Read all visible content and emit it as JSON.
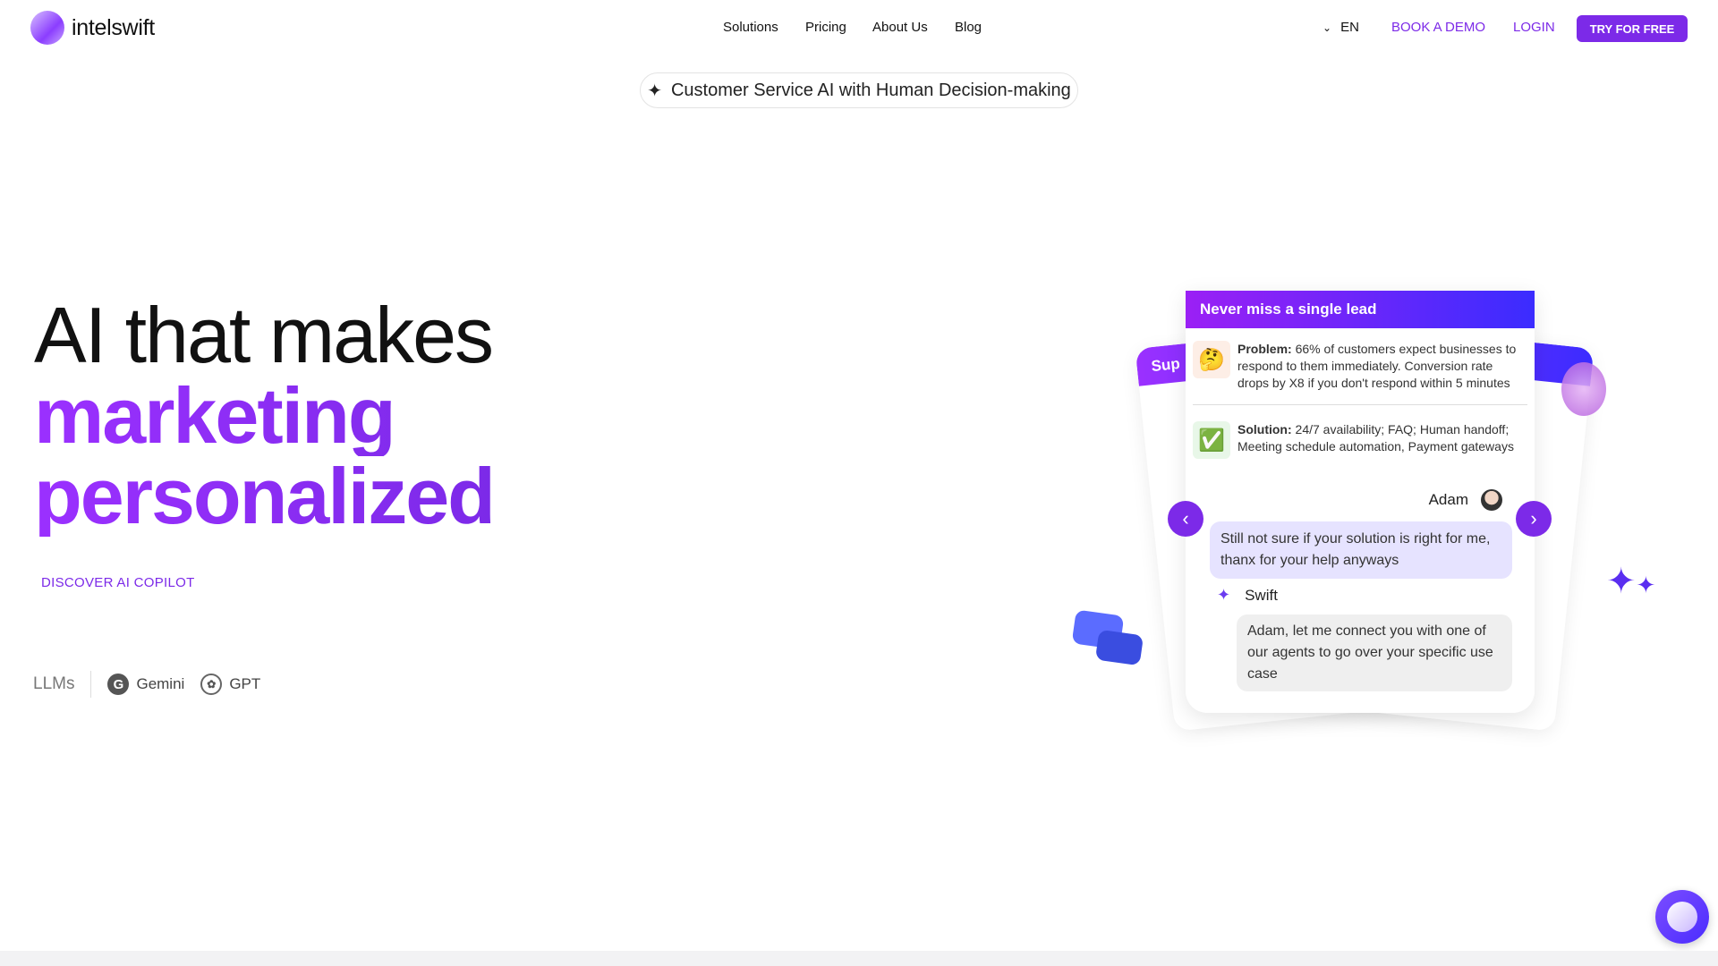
{
  "header": {
    "brand": "intelswift",
    "nav": [
      "Solutions",
      "Pricing",
      "About Us",
      "Blog"
    ],
    "language": "EN",
    "book_demo": "BOOK A DEMO",
    "login": "LOGIN",
    "try_free": "TRY FOR FREE"
  },
  "announcement": "Customer Service AI with Human Decision-making",
  "hero": {
    "line1": "AI that makes",
    "line2": "marketing",
    "line3": "personalized",
    "cta": "DISCOVER AI COPILOT"
  },
  "llms": {
    "label": "LLMs",
    "items": [
      "Gemini",
      "GPT"
    ]
  },
  "card": {
    "title": "Never miss a single lead",
    "problem_label": "Problem:",
    "problem_text": " 66% of customers expect businesses to respond to them immediately. Conversion rate drops by X8 if you don't respond within 5 minutes",
    "solution_label": "Solution:",
    "solution_text": " 24/7 availability; FAQ; Human handoff; Meeting schedule automation, Payment gateways",
    "user_name": "Adam",
    "user_message": "Still not sure if your solution is right for me, thanx for your help anyways",
    "bot_name": "Swift",
    "bot_message": "Adam, let me connect you with one of our agents to go over your specific use case"
  },
  "back_card_left_title": "Sup",
  "colors": {
    "accent": "#7c2ae8",
    "gradient_start": "#9b20f5",
    "gradient_end": "#3b2cff"
  }
}
